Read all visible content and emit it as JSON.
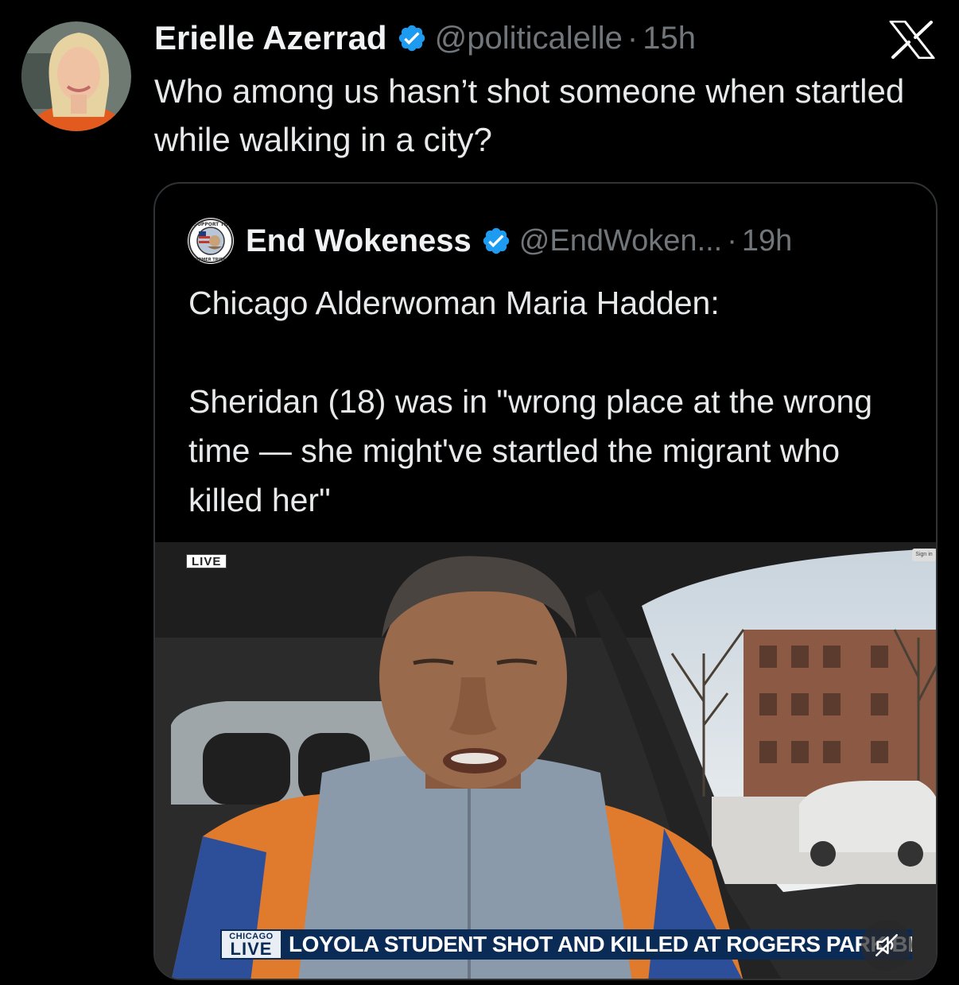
{
  "tweet": {
    "author_name": "Erielle Azerrad",
    "handle": "@politicalelle",
    "separator": "·",
    "time": "15h",
    "text": "Who among us hasn’t shot someone when startled while walking in a city?"
  },
  "quoted_tweet": {
    "author_name": "End Wokeness",
    "handle": "@EndWoken...",
    "separator": "·",
    "time": "19h",
    "text_line1": "Chicago Alderwoman Maria Hadden:",
    "text_line2": "Sheridan (18) was in \"wrong place at the wrong time — she might've startled the migrant who killed her\"",
    "avatar_ring_text_top": "I SUPPORT THE",
    "avatar_ring_text_bottom": "FARMER TRIBES"
  },
  "video": {
    "live_badge": "LIVE",
    "signin_label": "Sign in",
    "logo_small": "CHICAGO",
    "logo_big": "LIVE",
    "headline": "LOYOLA STUDENT SHOT AND KILLED AT ROGERS PARK BEACH"
  },
  "icons": {
    "platform": "x-logo-icon",
    "verified": "verified-badge-icon",
    "mute": "muted-speaker-icon"
  },
  "colors": {
    "background": "#000000",
    "text": "#e7e9ea",
    "secondary_text": "#71767b",
    "verified_blue": "#1d9bf0",
    "border": "#2f3336",
    "news_navy": "#0b2b57"
  }
}
